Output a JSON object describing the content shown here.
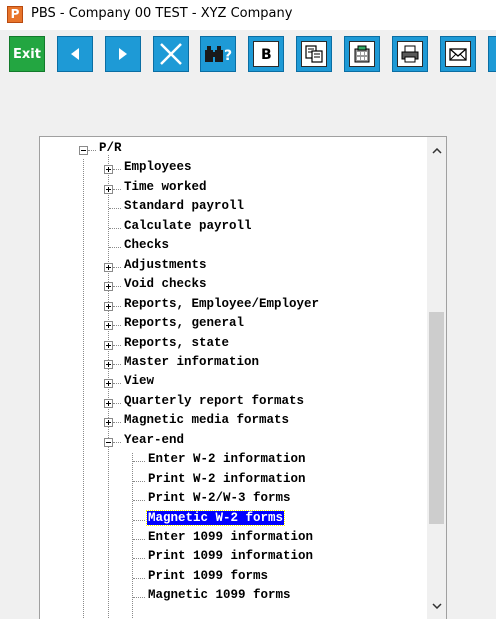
{
  "window": {
    "title": "PBS - Company 00  TEST - XYZ Company",
    "app_icon_letter": "P"
  },
  "toolbar": {
    "exit_label": "Exit",
    "icons": [
      "prev-arrow-icon",
      "next-arrow-icon",
      "cancel-x-icon",
      "find-binoculars-icon",
      "browse-b-icon",
      "copy-icon",
      "calculator-icon",
      "print-icon",
      "mail-icon"
    ]
  },
  "tree": {
    "root_label": "P/R",
    "items": [
      {
        "label": "Employees"
      },
      {
        "label": "Time worked"
      },
      {
        "label": "Standard payroll"
      },
      {
        "label": "Calculate payroll"
      },
      {
        "label": "Checks"
      },
      {
        "label": "Adjustments"
      },
      {
        "label": "Void checks"
      },
      {
        "label": "Reports, Employee/Employer"
      },
      {
        "label": "Reports, general"
      },
      {
        "label": "Reports, state"
      },
      {
        "label": "Master information"
      },
      {
        "label": "View"
      },
      {
        "label": "Quarterly report formats"
      },
      {
        "label": "Magnetic media formats"
      },
      {
        "label": "Year-end"
      }
    ],
    "year_end_children": [
      {
        "label": "Enter W-2 information"
      },
      {
        "label": "Print W-2 information"
      },
      {
        "label": "Print W-2/W-3 forms"
      },
      {
        "label": "Magnetic W-2 forms"
      },
      {
        "label": "Enter 1099 information"
      },
      {
        "label": "Print 1099 information"
      },
      {
        "label": "Print 1099 forms"
      },
      {
        "label": "Magnetic 1099 forms"
      }
    ],
    "selected": "Magnetic W-2 forms"
  },
  "colors": {
    "toolbar_blue": "#1e9ad6",
    "exit_green": "#23a641",
    "selection": "#0000ff",
    "app_icon": "#e8742a"
  }
}
